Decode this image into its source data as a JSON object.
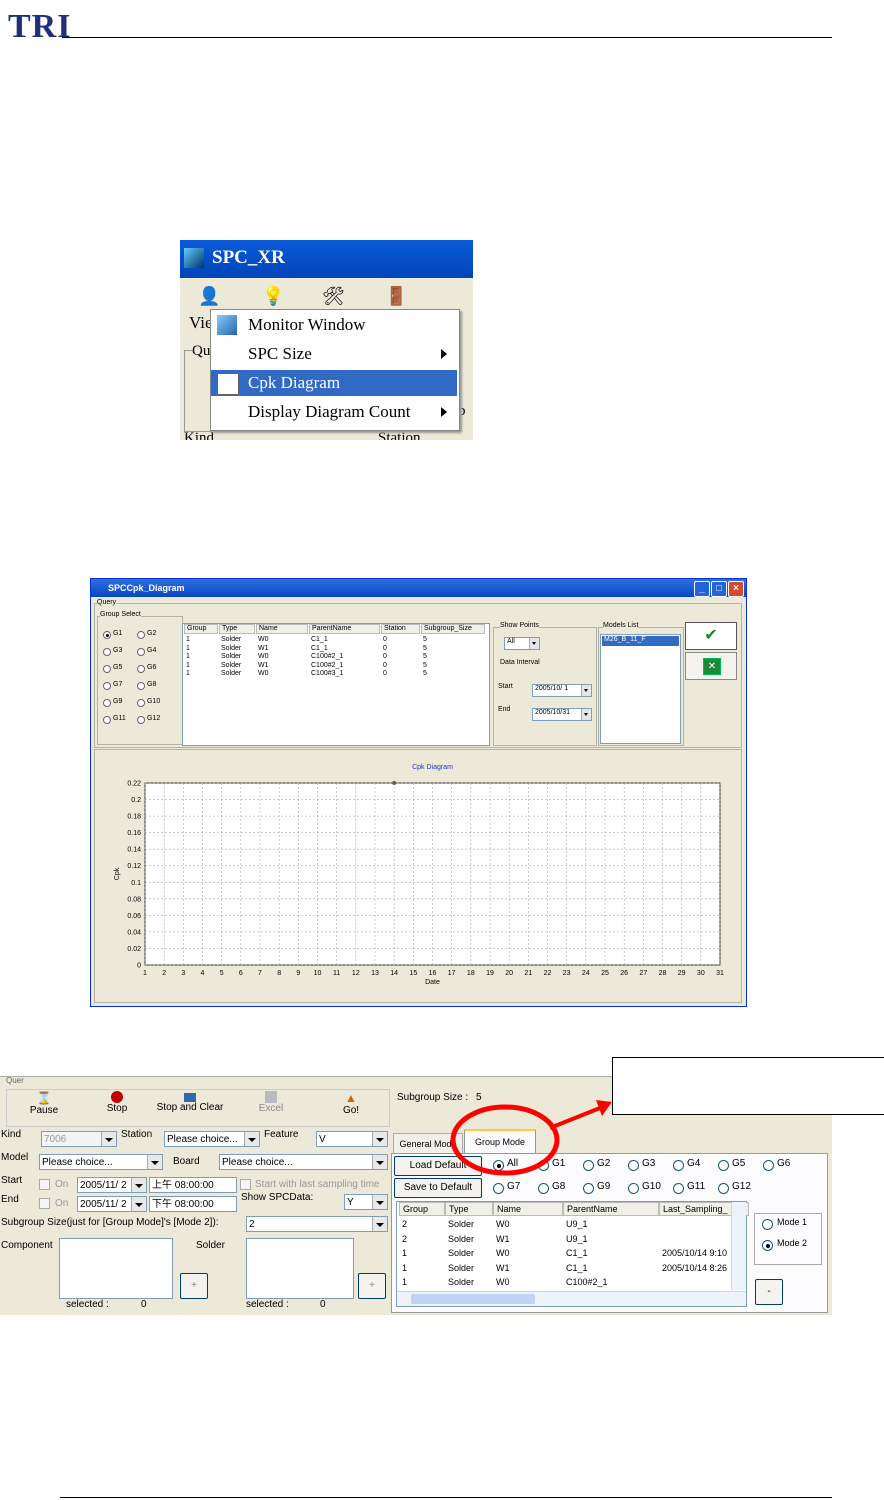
{
  "header": {
    "logo": "TRI"
  },
  "menu_screenshot": {
    "title": "SPC_XR",
    "menubar_partial": "Vie",
    "behind_text": [
      "Qu",
      "p",
      "Kind",
      "Station"
    ],
    "items": [
      {
        "label": "Monitor Window",
        "submenu": false,
        "selected": false
      },
      {
        "label": "SPC Size",
        "submenu": true,
        "selected": false
      },
      {
        "label": "Cpk Diagram",
        "submenu": false,
        "selected": true
      },
      {
        "label": "Display Diagram Count",
        "submenu": true,
        "selected": false
      }
    ]
  },
  "cpk_window": {
    "title": "SPCCpk_Diagram",
    "query_label": "Query",
    "group_select_label": "Group Select",
    "groups": [
      "G1",
      "G2",
      "G3",
      "G4",
      "G5",
      "G6",
      "G7",
      "G8",
      "G9",
      "G10",
      "G11",
      "G12"
    ],
    "selected_group": "G1",
    "table": {
      "columns": [
        "Group",
        "Type",
        "Name",
        "ParentName",
        "Station",
        "Subgroup_Size"
      ],
      "rows": [
        [
          "1",
          "Solder",
          "W0",
          "C1_1",
          "0",
          "5"
        ],
        [
          "1",
          "Solder",
          "W1",
          "C1_1",
          "0",
          "5"
        ],
        [
          "1",
          "Solder",
          "W0",
          "C100#2_1",
          "0",
          "5"
        ],
        [
          "1",
          "Solder",
          "W1",
          "C100#2_1",
          "0",
          "5"
        ],
        [
          "1",
          "Solder",
          "W0",
          "C100#3_1",
          "0",
          "5"
        ]
      ]
    },
    "show_points_label": "Show Points",
    "show_points_value": "All",
    "data_interval_label": "Data Interval",
    "start_label": "Start",
    "start_value": "2005/10/ 1",
    "end_label": "End",
    "end_value": "2005/10/31",
    "models_list_label": "Models List",
    "models": [
      "M26_B_11_F"
    ],
    "chart_title": "Cpk Diagram"
  },
  "chart_data": {
    "type": "scatter",
    "title": "Cpk Diagram",
    "xlabel": "Date",
    "ylabel": "Cpk",
    "x_ticks": [
      "1",
      "2",
      "3",
      "4",
      "5",
      "6",
      "7",
      "8",
      "9",
      "10",
      "11",
      "12",
      "13",
      "14",
      "15",
      "16",
      "17",
      "18",
      "19",
      "20",
      "21",
      "22",
      "23",
      "24",
      "25",
      "26",
      "27",
      "28",
      "29",
      "30",
      "31"
    ],
    "y_ticks": [
      "0",
      "0.02",
      "0.04",
      "0.06",
      "0.08",
      "0.1",
      "0.12",
      "0.14",
      "0.16",
      "0.18",
      "0.2",
      "0.22"
    ],
    "xlim": [
      1,
      31
    ],
    "ylim": [
      0,
      0.22
    ],
    "points": [
      {
        "x": 14,
        "y": 0.22
      }
    ],
    "grid": true,
    "point_color": "#556b2f"
  },
  "control_panel": {
    "tab_strip_partial": "Quer",
    "toolbar": {
      "pause": "Pause",
      "stop": "Stop",
      "stop_clear": "Stop and Clear",
      "excel": "Excel",
      "go": "Go!"
    },
    "subgroup_size_label": "Subgroup Size :",
    "subgroup_size_value": "5",
    "kind_label": "Kind",
    "kind_value": "7006",
    "station_label": "Station",
    "station_value": "Please choice...",
    "feature_label": "Feature",
    "feature_value": "V",
    "model_label": "Model",
    "model_value": "Please choice...",
    "board_label": "Board",
    "board_value": "Please choice...",
    "start_label": "Start",
    "start_on": "On",
    "start_date": "2005/11/ 2",
    "start_time": "上午 08:00:00",
    "start_with_last": "Start with last sampling time",
    "end_label": "End",
    "end_on": "On",
    "end_date": "2005/11/ 2",
    "end_time": "下午 08:00:00",
    "show_spcdata_label": "Show SPCData:",
    "show_spcdata_value": "Y",
    "subgroup_mode_label": "Subgroup Size(just for [Group Mode]'s [Mode 2]):",
    "subgroup_mode_value": "2",
    "component_label": "Component",
    "solder_label": "Solder",
    "selected_label": "selected :",
    "component_selected": "0",
    "solder_selected": "0",
    "plus": "+",
    "tabs": [
      "General Mode",
      "Group Mode"
    ],
    "active_tab": "Group Mode",
    "load_default": "Load Default",
    "save_default": "Save to Default",
    "group_radios": [
      "All",
      "G1",
      "G2",
      "G3",
      "G4",
      "G5",
      "G6",
      "G7",
      "G8",
      "G9",
      "G10",
      "G11",
      "G12"
    ],
    "group_table": {
      "columns": [
        "Group",
        "Type",
        "Name",
        "ParentName",
        "Last_Sampling_"
      ],
      "rows": [
        [
          "2",
          "Solder",
          "W0",
          "U9_1",
          ""
        ],
        [
          "2",
          "Solder",
          "W1",
          "U9_1",
          ""
        ],
        [
          "1",
          "Solder",
          "W0",
          "C1_1",
          "2005/10/14 9:10"
        ],
        [
          "1",
          "Solder",
          "W1",
          "C1_1",
          "2005/10/14 8:26"
        ],
        [
          "1",
          "Solder",
          "W0",
          "C100#2_1",
          ""
        ]
      ]
    },
    "mode1": "Mode 1",
    "mode2": "Mode 2",
    "minus": "-",
    "accent": "#ff0000"
  }
}
